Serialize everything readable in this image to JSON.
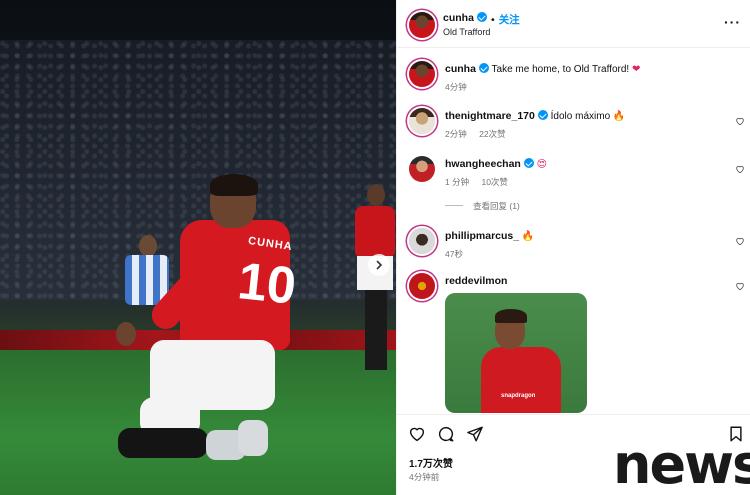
{
  "post": {
    "username": "cunha",
    "follow_label": "关注",
    "follow_separator": "•",
    "location": "Old Trafford",
    "more_label": "···",
    "caption_text": "Take me home, to Old Trafford!",
    "caption_emoji": "❤",
    "caption_time": "4分钟",
    "likes": "1.7万次赞",
    "posted_time": "4分钟前"
  },
  "photo": {
    "jersey_name": "CUNHA",
    "jersey_number": "10",
    "sponsor": "snapdragon"
  },
  "comments": [
    {
      "username": "thenightmare_170",
      "text": "Ídolo máximo",
      "emoji": "🔥",
      "time": "2分钟",
      "likes": "22次赞"
    },
    {
      "username": "hwangheechan",
      "text": "",
      "emoji": "😍",
      "time": "1 分钟",
      "likes": "10次赞",
      "view_replies": "查看回复 (1)"
    },
    {
      "username": "phillipmarcus_",
      "text": "",
      "emoji": "🔥",
      "time": "47秒"
    },
    {
      "username": "reddevilmon",
      "gif_text": "snapdragon"
    }
  ],
  "watermark": "news",
  "colors": {
    "accent": "#0095f6",
    "jersey_red": "#d51920",
    "muted": "#737373"
  }
}
